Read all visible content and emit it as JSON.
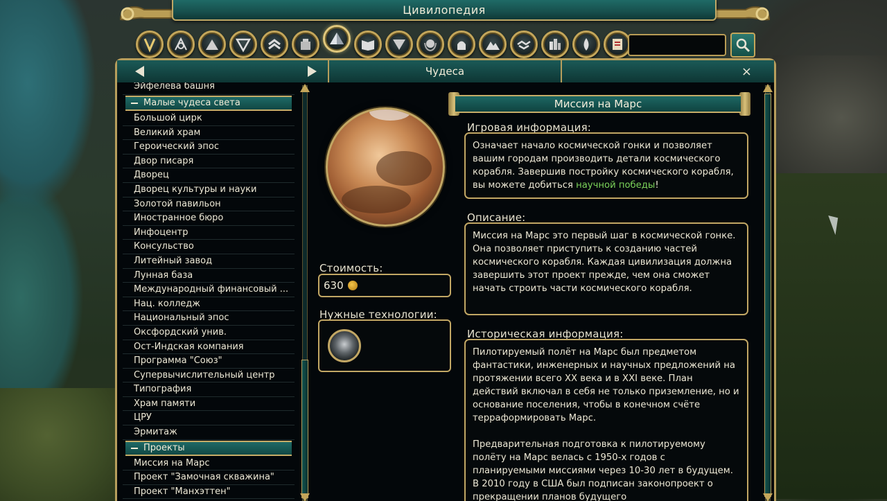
{
  "app": {
    "title": "Цивилопедия"
  },
  "categories": [
    {
      "icon": "civ-v-icon"
    },
    {
      "icon": "compass-icon"
    },
    {
      "icon": "pyramid-small-icon"
    },
    {
      "icon": "triangle-emblem-icon"
    },
    {
      "icon": "chevron-rank-icon"
    },
    {
      "icon": "building-icon"
    },
    {
      "icon": "pyramid-icon",
      "active": true
    },
    {
      "icon": "book-icon"
    },
    {
      "icon": "triangle-badge-icon"
    },
    {
      "icon": "laurel-globe-icon"
    },
    {
      "icon": "capitol-icon"
    },
    {
      "icon": "mountain-icon"
    },
    {
      "icon": "handshake-icon"
    },
    {
      "icon": "city-icon"
    },
    {
      "icon": "drop-icon"
    },
    {
      "icon": "scroll-icon"
    }
  ],
  "search": {
    "value": ""
  },
  "header": {
    "section_title": "Чудеса",
    "close_label": "×"
  },
  "list": {
    "top_item": "Эйфелева башня",
    "sections": [
      {
        "title": "Малые чудеса света",
        "items": [
          "Большой цирк",
          "Великий храм",
          "Героический эпос",
          "Двор писаря",
          "Дворец",
          "Дворец культуры и науки",
          "Золотой павильон",
          "Иностранное бюро",
          "Инфоцентр",
          "Консульство",
          "Литейный завод",
          "Лунная база",
          "Международный финансовый ...",
          "Нац. колледж",
          "Национальный эпос",
          "Оксфордский унив.",
          "Ост-Индская компания",
          "Программа \"Союз\"",
          "Супервычислительный центр",
          "Типография",
          "Храм памяти",
          "ЦРУ",
          "Эрмитаж"
        ]
      },
      {
        "title": "Проекты",
        "items": [
          "Миссия на Марс",
          "Проект \"Замочная скважина\"",
          "Проект \"Манхэттен\""
        ]
      }
    ]
  },
  "article": {
    "name": "Миссия на Марс",
    "cost_label": "Стоимость:",
    "cost_value": "630",
    "tech_label": "Нужные технологии:",
    "tech_icon": "astronaut-icon",
    "game_info_label": "Игровая информация:",
    "game_info_text": "Означает начало космической гонки и позволяет вашим городам производить детали космического корабля. Завершив постройку космического корабля, вы можете добиться ",
    "game_info_link": "научной победы",
    "game_info_end": "!",
    "description_label": "Описание:",
    "description_text": "Миссия на Марс это первый шаг в космической гонке. Она позволяет приступить к созданию частей космического корабля. Каждая цивилизация должна завершить этот проект прежде, чем она сможет начать строить части космического корабля.",
    "history_label": "Историческая информация:",
    "history_p1": "Пилотируемый полёт на Марс был предметом фантастики, инженерных и научных предложений на протяжении всего XX века и в XXI веке. План действий включал в себя не только приземление, но и основание поселения, чтобы в конечном счёте терраформировать Марс.",
    "history_p2": "Предварительная подготовка к пилотируемому полёту на Марс велась с 1950-х годов с планируемыми миссиями через 10-30 лет в будущем. В 2010 году в США был подписан законопроект о прекращении планов будущего"
  },
  "colors": {
    "accent_gold": "#c2a764",
    "teal": "#1d6763",
    "link_green": "#7bd35a"
  }
}
